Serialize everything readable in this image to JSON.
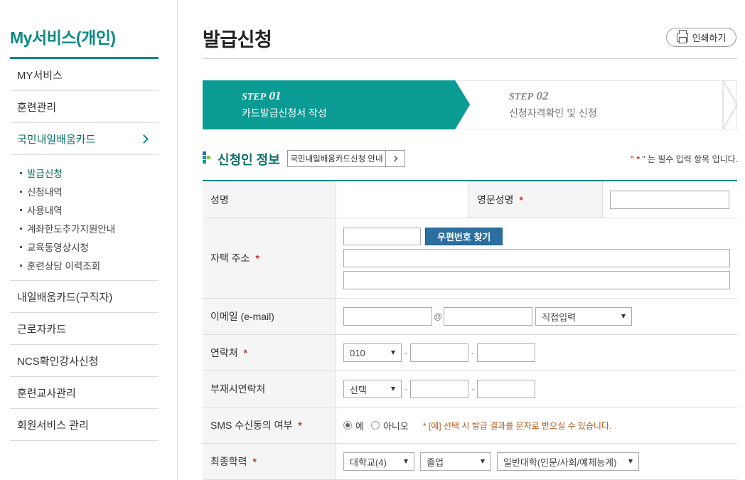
{
  "sidebar": {
    "title": "My서비스(개인)",
    "items": [
      {
        "label": "MY서비스"
      },
      {
        "label": "훈련관리"
      },
      {
        "label": "국민내일배움카드"
      }
    ],
    "subitems": [
      {
        "label": "발급신청"
      },
      {
        "label": "신청내역"
      },
      {
        "label": "사용내역"
      },
      {
        "label": "계좌한도추가지원안내"
      },
      {
        "label": "교육동영상시청"
      },
      {
        "label": "훈련상담 이력조회"
      }
    ],
    "items_after": [
      {
        "label": "내일배움카드(구직자)"
      },
      {
        "label": "근로자카드"
      },
      {
        "label": "NCS확인강사신청"
      },
      {
        "label": "훈련교사관리"
      },
      {
        "label": "회원서비스 관리"
      }
    ]
  },
  "header": {
    "title": "발급신청",
    "print_label": "인쇄하기"
  },
  "steps": [
    {
      "prefix": "STEP",
      "number": "01",
      "label": "카드발급신청서 작성"
    },
    {
      "prefix": "STEP",
      "number": "02",
      "label": "신청자격확인 및 신청"
    }
  ],
  "section": {
    "title": "신청인 정보",
    "guide_button": "국민내일배움카드신청 안내",
    "required_prefix": "\"",
    "required_mark": "*",
    "required_suffix": "\" 는 필수 입력 항목 입니다."
  },
  "form": {
    "name_label": "성명",
    "eng_name_label": "영문성명",
    "address_label": "자택 주소",
    "zip_button": "우편번호 찾기",
    "email_label": "이메일 (e-mail)",
    "email_at": "@",
    "email_domain_select": "직접입력",
    "phone_label": "연락처",
    "phone_prefix": "010",
    "alt_phone_label": "부재시연락처",
    "alt_phone_prefix": "선택",
    "dash": "-",
    "sms_label": "SMS 수신동의 여부",
    "sms_yes": "예",
    "sms_no": "아니오",
    "sms_note": "* [예] 선택 시 발급 결과를 문자로 받으실 수 있습니다.",
    "edu_label": "최종학력",
    "edu_level": "대학교(4)",
    "edu_status": "졸업",
    "edu_type": "일반대학(인문/사회/예체능계)",
    "req": "*"
  },
  "colors": {
    "accent": "#0a8a83",
    "zip_button": "#2b6ea0",
    "required": "#c0392b"
  }
}
